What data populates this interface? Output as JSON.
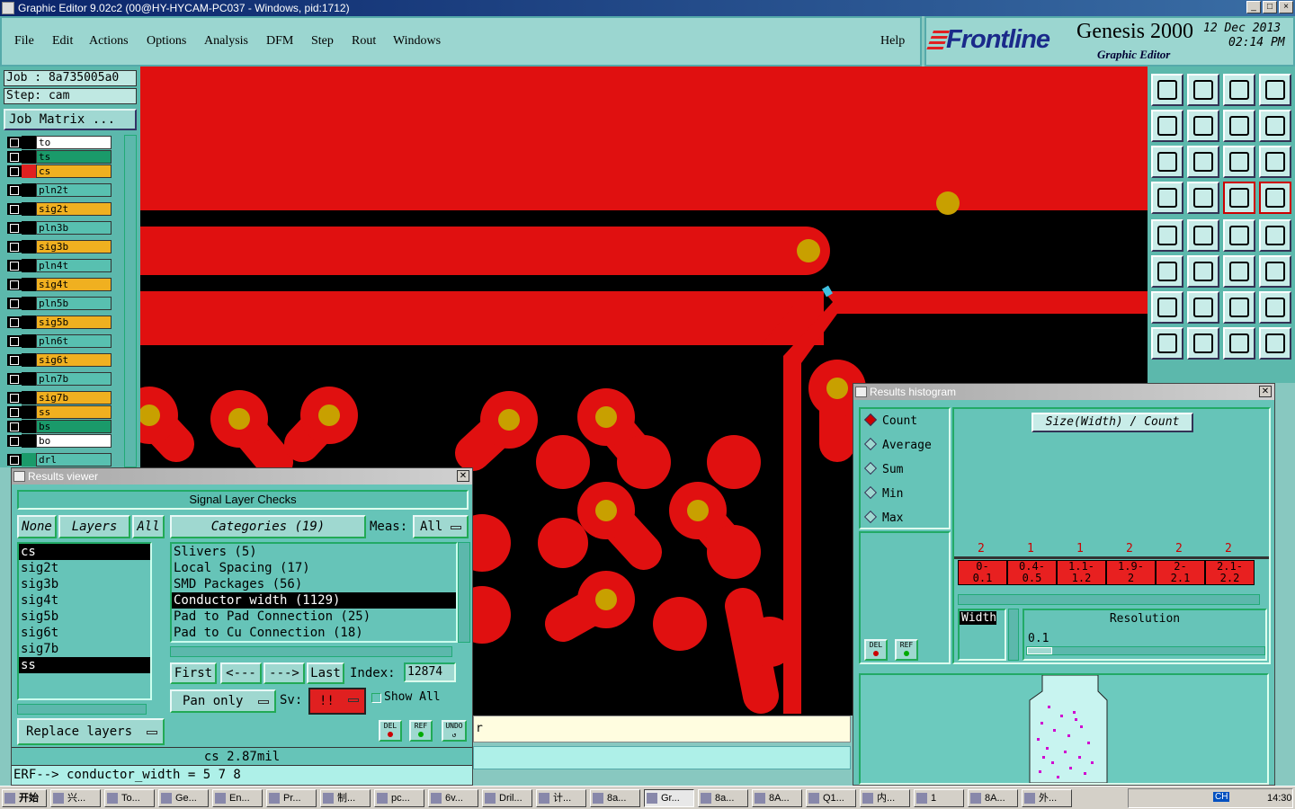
{
  "window": {
    "title": "Graphic Editor 9.02c2 (00@HY-HYCAM-PC037 - Windows, pid:1712)",
    "btn_min": "_",
    "btn_max": "□",
    "btn_close": "×"
  },
  "menu": {
    "items": [
      "File",
      "Edit",
      "Actions",
      "Options",
      "Analysis",
      "DFM",
      "Step",
      "Rout",
      "Windows"
    ],
    "help": "Help"
  },
  "logo": {
    "brand": "Frontline",
    "product": "Genesis 2000",
    "subtitle": "Graphic Editor",
    "date": "12 Dec 2013",
    "time": "02:14 PM"
  },
  "job": {
    "job_label": "Job : 8a735005a0",
    "step_label": "Step: cam",
    "matrix_button": "Job Matrix ..."
  },
  "layers": [
    {
      "name": "to",
      "color": "#ffffff",
      "sw": "#000000"
    },
    {
      "name": "ts",
      "color": "#1a9a6a",
      "sw": "#000000"
    },
    {
      "name": "cs",
      "color": "#f0b020",
      "sw": "#e02020"
    },
    {
      "name": "pln2t",
      "color": "#58c0b0",
      "sw": "#000000"
    },
    {
      "name": "sig2t",
      "color": "#f0b020",
      "sw": "#000000"
    },
    {
      "name": "pln3b",
      "color": "#58c0b0",
      "sw": "#000000"
    },
    {
      "name": "sig3b",
      "color": "#f0b020",
      "sw": "#000000"
    },
    {
      "name": "pln4t",
      "color": "#58c0b0",
      "sw": "#000000"
    },
    {
      "name": "sig4t",
      "color": "#f0b020",
      "sw": "#000000"
    },
    {
      "name": "pln5b",
      "color": "#58c0b0",
      "sw": "#000000"
    },
    {
      "name": "sig5b",
      "color": "#f0b020",
      "sw": "#000000"
    },
    {
      "name": "pln6t",
      "color": "#58c0b0",
      "sw": "#000000"
    },
    {
      "name": "sig6t",
      "color": "#f0b020",
      "sw": "#000000"
    },
    {
      "name": "pln7b",
      "color": "#58c0b0",
      "sw": "#000000"
    },
    {
      "name": "sig7b",
      "color": "#f0b020",
      "sw": "#000000"
    },
    {
      "name": "ss",
      "color": "#f0b020",
      "sw": "#000000"
    },
    {
      "name": "bs",
      "color": "#1a9a6a",
      "sw": "#000000"
    },
    {
      "name": "bo",
      "color": "#ffffff",
      "sw": "#000000"
    },
    {
      "name": "drl",
      "color": "#58c0b0",
      "sw": "#1a9a6a"
    }
  ],
  "results_viewer": {
    "title": "Results viewer",
    "header": "Signal Layer Checks",
    "none_btn": "None",
    "layers_btn": "Layers",
    "all_btn": "All",
    "categories_label": "Categories (19)",
    "meas_label": "Meas:",
    "meas_value": "All",
    "layer_list": [
      "cs",
      "sig2t",
      "sig3b",
      "sig4t",
      "sig5b",
      "sig6t",
      "sig7b",
      "ss"
    ],
    "categories": [
      "Slivers (5)",
      "Local Spacing (17)",
      "SMD Packages (56)",
      "Conductor width (1129)",
      "Pad to Pad Connection (25)",
      "Pad to Cu Connection (18)"
    ],
    "first": "First",
    "prev": "<---",
    "next": "--->",
    "last": "Last",
    "index_label": "Index:",
    "index_value": "12874",
    "pan": "Pan only",
    "sv_label": "Sv:",
    "sv_value": "!!",
    "show_all": "Show All",
    "replace": "Replace layers",
    "del": "DEL",
    "ref": "REF",
    "undo": "UNDO",
    "status": "cs 2.87mil",
    "erf": "ERF--> conductor_width = 5 7 8"
  },
  "histogram": {
    "title": "Results histogram",
    "modes": [
      "Count",
      "Average",
      "Sum",
      "Min",
      "Max"
    ],
    "chart_title": "Size(Width) / Count",
    "counts": [
      "2",
      "1",
      "1",
      "2",
      "2",
      "2"
    ],
    "bins": [
      "0-\n0.1",
      "0.4-\n0.5",
      "1.1-\n1.2",
      "1.9-\n2",
      "2-\n2.1",
      "2.1-\n2.2"
    ],
    "width_label": "Width",
    "resolution_label": "Resolution",
    "resolution_value": "0.1",
    "del": "DEL",
    "ref": "REF"
  },
  "bg_text": "r",
  "taskbar": {
    "start": "开始",
    "items": [
      "兴...",
      "To...",
      "Ge...",
      "En...",
      "Pr...",
      "制...",
      "pc...",
      "6v...",
      "Dril...",
      "计...",
      "8a...",
      "Gr...",
      "8a...",
      "8A...",
      "Q1...",
      "内...",
      "1",
      "8A...",
      "外..."
    ],
    "time": "14:30",
    "lang": "CH"
  },
  "colors": {
    "copper": "#e01010",
    "pad": "#c8a000",
    "bg": "#000000"
  }
}
